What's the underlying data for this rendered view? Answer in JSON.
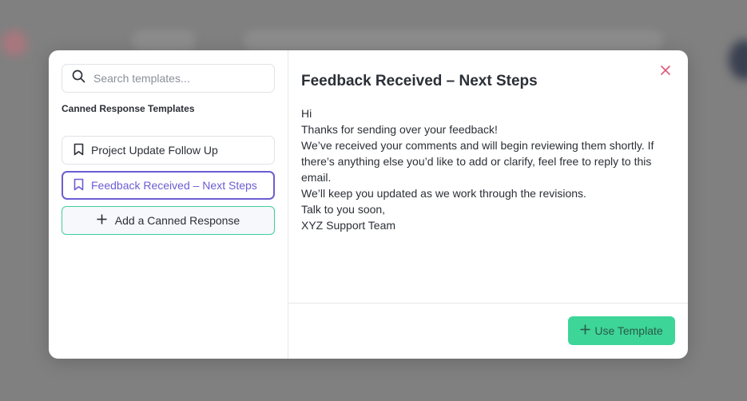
{
  "search": {
    "placeholder": "Search templates..."
  },
  "sidebar": {
    "section_title": "Canned Response Templates",
    "templates": [
      {
        "label": "Project Update Follow Up",
        "icon": "bookmark-icon",
        "active": false
      },
      {
        "label": "Feedback Received – Next Steps",
        "icon": "bookmark-icon",
        "active": true
      }
    ],
    "add_button_label": "Add a Canned Response"
  },
  "preview": {
    "title": "Feedback Received – Next Steps",
    "body": [
      "Hi",
      "Thanks for sending over your feedback!",
      "We’ve received your comments and will begin reviewing them shortly. If there’s anything else you’d like to add or clarify, feel free to reply to this email.",
      "We’ll keep you updated as we work through the revisions.",
      "Talk to you soon,",
      "XYZ Support Team"
    ]
  },
  "footer": {
    "use_button_label": "Use Template"
  },
  "colors": {
    "accent_purple": "#6c5dd3",
    "accent_green": "#3dd598",
    "close_pink": "#e05a7a"
  }
}
